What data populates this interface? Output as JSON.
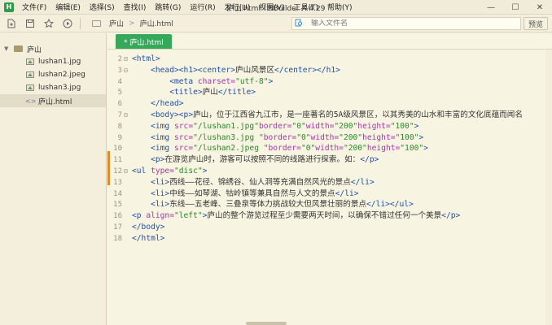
{
  "window": {
    "title": "庐山.html - HBuilder X 4.29",
    "logo": "H",
    "controls": [
      "—",
      "☐",
      "✕"
    ]
  },
  "menu": [
    "文件(F)",
    "编辑(E)",
    "选择(S)",
    "查找(I)",
    "跳转(G)",
    "运行(R)",
    "发行(U)",
    "视图(V)",
    "工具(T)",
    "帮助(Y)"
  ],
  "toolbar": {
    "breadcrumb": [
      "庐山",
      "庐山.html"
    ],
    "search_placeholder": "输入文件名",
    "preview_label": "预览"
  },
  "sidebar": {
    "folder": "庐山",
    "files": [
      "lushan1.jpg",
      "lushan2.jpeg",
      "lushan3.jpg",
      "庐山.html"
    ],
    "selected": "庐山.html"
  },
  "editor": {
    "tab": "* 庐山.html",
    "lines": [
      {
        "n": "2",
        "fold": "⊟",
        "segs": [
          [
            "t",
            "<html>"
          ]
        ]
      },
      {
        "n": "3",
        "fold": "⊟",
        "segs": [
          [
            "x",
            "    "
          ],
          [
            "t",
            "<head><h1><center>"
          ],
          [
            "x",
            "庐山风景区"
          ],
          [
            "t",
            "</center></h1>"
          ]
        ]
      },
      {
        "n": "4",
        "fold": "",
        "segs": [
          [
            "x",
            "        "
          ],
          [
            "t",
            "<meta "
          ],
          [
            "a",
            "charset="
          ],
          [
            "s",
            "\"utf-8\""
          ],
          [
            "t",
            ">"
          ]
        ]
      },
      {
        "n": "5",
        "fold": "",
        "segs": [
          [
            "x",
            "        "
          ],
          [
            "t",
            "<title>"
          ],
          [
            "x",
            "庐山"
          ],
          [
            "t",
            "</title>"
          ]
        ]
      },
      {
        "n": "6",
        "fold": "",
        "segs": [
          [
            "x",
            "    "
          ],
          [
            "t",
            "</head>"
          ]
        ]
      },
      {
        "n": "7",
        "fold": "⊟",
        "segs": [
          [
            "x",
            "    "
          ],
          [
            "t",
            "<body><p>"
          ],
          [
            "x",
            "庐山，位于江西省九江市，是一座著名的5A级风景区，以其秀美的山水和丰富的文化底蕴而闻名"
          ]
        ]
      },
      {
        "n": "8",
        "fold": "",
        "segs": [
          [
            "x",
            "    "
          ],
          [
            "t",
            "<img "
          ],
          [
            "a",
            "src="
          ],
          [
            "s",
            "\"/lushan1.jpg\""
          ],
          [
            "a",
            "border="
          ],
          [
            "s",
            "\"0\""
          ],
          [
            "a",
            "width="
          ],
          [
            "s",
            "\"200\""
          ],
          [
            "a",
            "height="
          ],
          [
            "s",
            "\"100\""
          ],
          [
            "t",
            ">"
          ]
        ]
      },
      {
        "n": "9",
        "fold": "",
        "segs": [
          [
            "x",
            "    "
          ],
          [
            "t",
            "<img "
          ],
          [
            "a",
            "src="
          ],
          [
            "s",
            "\"/lushan3.jpg \""
          ],
          [
            "a",
            "border="
          ],
          [
            "s",
            "\"0\""
          ],
          [
            "a",
            "width="
          ],
          [
            "s",
            "\"200\""
          ],
          [
            "a",
            "height="
          ],
          [
            "s",
            "\"100\""
          ],
          [
            "t",
            ">"
          ]
        ]
      },
      {
        "n": "10",
        "fold": "",
        "segs": [
          [
            "x",
            "    "
          ],
          [
            "t",
            "<img "
          ],
          [
            "a",
            "src="
          ],
          [
            "s",
            "\"/lushan2.jpeg \""
          ],
          [
            "a",
            "border="
          ],
          [
            "s",
            "\"0\""
          ],
          [
            "a",
            "width="
          ],
          [
            "s",
            "\"200\""
          ],
          [
            "a",
            "height="
          ],
          [
            "s",
            "\"100\""
          ],
          [
            "t",
            ">"
          ]
        ]
      },
      {
        "n": "11",
        "fold": "",
        "segs": [
          [
            "x",
            "    "
          ],
          [
            "t",
            "<p>"
          ],
          [
            "x",
            "在游览庐山时，游客可以按照不同的线路进行探索。如："
          ],
          [
            "t",
            "</p>"
          ]
        ]
      },
      {
        "n": "12",
        "fold": "⊟",
        "segs": [
          [
            "t",
            "<ul "
          ],
          [
            "a",
            "type="
          ],
          [
            "s",
            "\"disc\""
          ],
          [
            "t",
            ">"
          ]
        ]
      },
      {
        "n": "13",
        "fold": "",
        "segs": [
          [
            "x",
            "    "
          ],
          [
            "t",
            "<li>"
          ],
          [
            "x",
            "西线——花径、锦绣谷、仙人洞等充满自然风光的景点"
          ],
          [
            "t",
            "</li>"
          ]
        ]
      },
      {
        "n": "14",
        "fold": "",
        "segs": [
          [
            "x",
            "    "
          ],
          [
            "t",
            "<li>"
          ],
          [
            "x",
            "中线——如琴湖、牯岭镇等兼具自然与人文的景点"
          ],
          [
            "t",
            "</li>"
          ]
        ]
      },
      {
        "n": "15",
        "fold": "",
        "segs": [
          [
            "x",
            "    "
          ],
          [
            "t",
            "<li>"
          ],
          [
            "x",
            "东线——五老峰、三叠泉等体力挑战较大但风景壮丽的景点"
          ],
          [
            "t",
            "</li></ul>"
          ]
        ]
      },
      {
        "n": "16",
        "fold": "",
        "segs": [
          [
            "t",
            "<p "
          ],
          [
            "a",
            "align="
          ],
          [
            "s",
            "\"left\""
          ],
          [
            "t",
            ">"
          ],
          [
            "x",
            "庐山的整个游览过程至少需要两天时间，以确保不错过任何一个美景"
          ],
          [
            "t",
            "</p>"
          ]
        ]
      },
      {
        "n": "17",
        "fold": "",
        "segs": [
          [
            "t",
            "</body>"
          ]
        ]
      },
      {
        "n": "18",
        "fold": "",
        "segs": [
          [
            "t",
            "</html>"
          ]
        ]
      }
    ]
  }
}
